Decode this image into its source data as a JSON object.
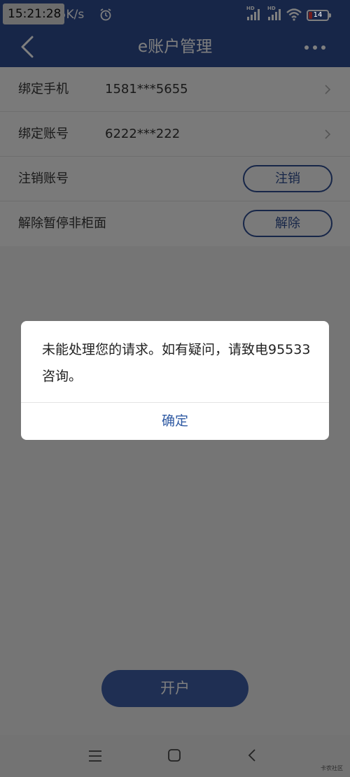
{
  "status_bar": {
    "time": "15:21:28",
    "net_speed": "405K/s",
    "hd_1": "HD",
    "hd_2": "HD",
    "battery": "14",
    "battery_color": "#e13b3b"
  },
  "header": {
    "title": "e账户管理",
    "bg_color": "#2f4d91"
  },
  "list": {
    "rows": [
      {
        "label": "绑定手机",
        "value": "1581***5655"
      },
      {
        "label": "绑定账号",
        "value": "6222***222"
      },
      {
        "label": "注销账号",
        "action": "注销"
      },
      {
        "label": "解除暂停非柜面",
        "action": "解除"
      }
    ]
  },
  "open_account": {
    "label": "开户"
  },
  "dialog": {
    "message": "未能处理您的请求。如有疑问，请致电95533咨询。",
    "confirm_label": "确定"
  },
  "nav": {
    "watermark": "卡农社区"
  }
}
